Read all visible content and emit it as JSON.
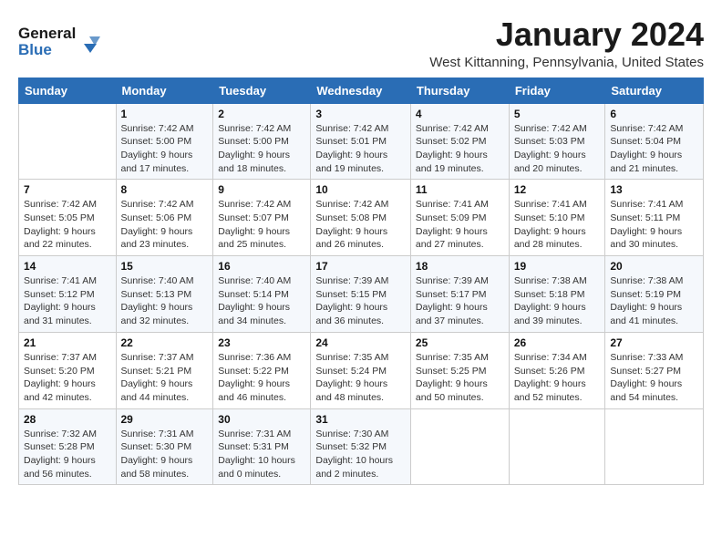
{
  "logo": {
    "line1": "General",
    "line2": "Blue"
  },
  "title": "January 2024",
  "location": "West Kittanning, Pennsylvania, United States",
  "days_of_week": [
    "Sunday",
    "Monday",
    "Tuesday",
    "Wednesday",
    "Thursday",
    "Friday",
    "Saturday"
  ],
  "weeks": [
    [
      {
        "num": "",
        "info": ""
      },
      {
        "num": "1",
        "info": "Sunrise: 7:42 AM\nSunset: 5:00 PM\nDaylight: 9 hours\nand 17 minutes."
      },
      {
        "num": "2",
        "info": "Sunrise: 7:42 AM\nSunset: 5:00 PM\nDaylight: 9 hours\nand 18 minutes."
      },
      {
        "num": "3",
        "info": "Sunrise: 7:42 AM\nSunset: 5:01 PM\nDaylight: 9 hours\nand 19 minutes."
      },
      {
        "num": "4",
        "info": "Sunrise: 7:42 AM\nSunset: 5:02 PM\nDaylight: 9 hours\nand 19 minutes."
      },
      {
        "num": "5",
        "info": "Sunrise: 7:42 AM\nSunset: 5:03 PM\nDaylight: 9 hours\nand 20 minutes."
      },
      {
        "num": "6",
        "info": "Sunrise: 7:42 AM\nSunset: 5:04 PM\nDaylight: 9 hours\nand 21 minutes."
      }
    ],
    [
      {
        "num": "7",
        "info": "Sunrise: 7:42 AM\nSunset: 5:05 PM\nDaylight: 9 hours\nand 22 minutes."
      },
      {
        "num": "8",
        "info": "Sunrise: 7:42 AM\nSunset: 5:06 PM\nDaylight: 9 hours\nand 23 minutes."
      },
      {
        "num": "9",
        "info": "Sunrise: 7:42 AM\nSunset: 5:07 PM\nDaylight: 9 hours\nand 25 minutes."
      },
      {
        "num": "10",
        "info": "Sunrise: 7:42 AM\nSunset: 5:08 PM\nDaylight: 9 hours\nand 26 minutes."
      },
      {
        "num": "11",
        "info": "Sunrise: 7:41 AM\nSunset: 5:09 PM\nDaylight: 9 hours\nand 27 minutes."
      },
      {
        "num": "12",
        "info": "Sunrise: 7:41 AM\nSunset: 5:10 PM\nDaylight: 9 hours\nand 28 minutes."
      },
      {
        "num": "13",
        "info": "Sunrise: 7:41 AM\nSunset: 5:11 PM\nDaylight: 9 hours\nand 30 minutes."
      }
    ],
    [
      {
        "num": "14",
        "info": "Sunrise: 7:41 AM\nSunset: 5:12 PM\nDaylight: 9 hours\nand 31 minutes."
      },
      {
        "num": "15",
        "info": "Sunrise: 7:40 AM\nSunset: 5:13 PM\nDaylight: 9 hours\nand 32 minutes."
      },
      {
        "num": "16",
        "info": "Sunrise: 7:40 AM\nSunset: 5:14 PM\nDaylight: 9 hours\nand 34 minutes."
      },
      {
        "num": "17",
        "info": "Sunrise: 7:39 AM\nSunset: 5:15 PM\nDaylight: 9 hours\nand 36 minutes."
      },
      {
        "num": "18",
        "info": "Sunrise: 7:39 AM\nSunset: 5:17 PM\nDaylight: 9 hours\nand 37 minutes."
      },
      {
        "num": "19",
        "info": "Sunrise: 7:38 AM\nSunset: 5:18 PM\nDaylight: 9 hours\nand 39 minutes."
      },
      {
        "num": "20",
        "info": "Sunrise: 7:38 AM\nSunset: 5:19 PM\nDaylight: 9 hours\nand 41 minutes."
      }
    ],
    [
      {
        "num": "21",
        "info": "Sunrise: 7:37 AM\nSunset: 5:20 PM\nDaylight: 9 hours\nand 42 minutes."
      },
      {
        "num": "22",
        "info": "Sunrise: 7:37 AM\nSunset: 5:21 PM\nDaylight: 9 hours\nand 44 minutes."
      },
      {
        "num": "23",
        "info": "Sunrise: 7:36 AM\nSunset: 5:22 PM\nDaylight: 9 hours\nand 46 minutes."
      },
      {
        "num": "24",
        "info": "Sunrise: 7:35 AM\nSunset: 5:24 PM\nDaylight: 9 hours\nand 48 minutes."
      },
      {
        "num": "25",
        "info": "Sunrise: 7:35 AM\nSunset: 5:25 PM\nDaylight: 9 hours\nand 50 minutes."
      },
      {
        "num": "26",
        "info": "Sunrise: 7:34 AM\nSunset: 5:26 PM\nDaylight: 9 hours\nand 52 minutes."
      },
      {
        "num": "27",
        "info": "Sunrise: 7:33 AM\nSunset: 5:27 PM\nDaylight: 9 hours\nand 54 minutes."
      }
    ],
    [
      {
        "num": "28",
        "info": "Sunrise: 7:32 AM\nSunset: 5:28 PM\nDaylight: 9 hours\nand 56 minutes."
      },
      {
        "num": "29",
        "info": "Sunrise: 7:31 AM\nSunset: 5:30 PM\nDaylight: 9 hours\nand 58 minutes."
      },
      {
        "num": "30",
        "info": "Sunrise: 7:31 AM\nSunset: 5:31 PM\nDaylight: 10 hours\nand 0 minutes."
      },
      {
        "num": "31",
        "info": "Sunrise: 7:30 AM\nSunset: 5:32 PM\nDaylight: 10 hours\nand 2 minutes."
      },
      {
        "num": "",
        "info": ""
      },
      {
        "num": "",
        "info": ""
      },
      {
        "num": "",
        "info": ""
      }
    ]
  ]
}
